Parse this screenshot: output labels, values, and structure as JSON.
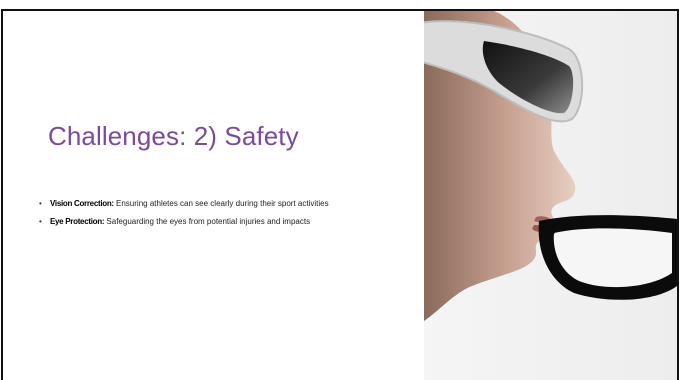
{
  "slide": {
    "title": "Challenges: 2) Safety",
    "bullets": [
      {
        "term": "Vision Correction:",
        "text": " Ensuring athletes can see clearly during their sport activities"
      },
      {
        "term": "Eye Protection:",
        "text": " Safeguarding the eyes from potential injuries and impacts"
      }
    ],
    "bullet_glyph": "•"
  },
  "colors": {
    "title": "#7b4a9c",
    "border": "#111111"
  }
}
